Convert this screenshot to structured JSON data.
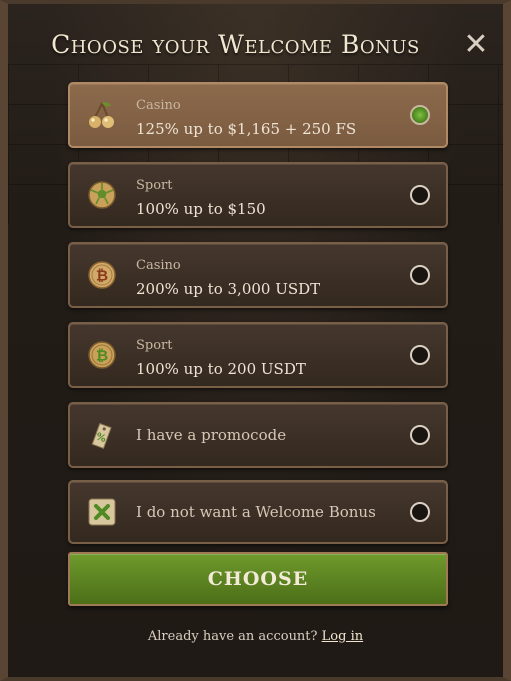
{
  "modal": {
    "title": "Choose your Welcome Bonus",
    "close_icon": "close-icon"
  },
  "options": [
    {
      "kicker": "Casino",
      "label": "125% up to $1,165 + 250 FS",
      "icon": "cherry-icon",
      "selected": true
    },
    {
      "kicker": "Sport",
      "label": "100% up to $150",
      "icon": "soccer-ball-icon",
      "selected": false
    },
    {
      "kicker": "Casino",
      "label": "200% up to 3,000 USDT",
      "icon": "bitcoin-coin-icon",
      "selected": false
    },
    {
      "kicker": "Sport",
      "label": "100% up to 200 USDT",
      "icon": "bitcoin-coin-green-icon",
      "selected": false
    },
    {
      "label": "I have a promocode",
      "icon": "tag-icon",
      "selected": false
    },
    {
      "label": "I do not want a Welcome Bonus",
      "icon": "x-card-icon",
      "selected": false
    }
  ],
  "choose_button": "CHOOSE",
  "footer": {
    "text": "Already have an account?",
    "link": "Log in"
  },
  "colors": {
    "accent_green": "#5b8221",
    "selected_bg": "#8c6a4c",
    "option_bg": "#3b2f25"
  }
}
